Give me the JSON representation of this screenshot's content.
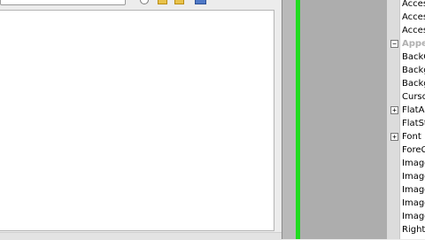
{
  "properties": {
    "rows": [
      {
        "label": "Acces",
        "toggle": ""
      },
      {
        "label": "Acces",
        "toggle": ""
      },
      {
        "label": "Acces",
        "toggle": ""
      },
      {
        "label": "Appe",
        "toggle": "−",
        "category": true
      },
      {
        "label": "BackC",
        "toggle": ""
      },
      {
        "label": "Backg",
        "toggle": ""
      },
      {
        "label": "Backg",
        "toggle": ""
      },
      {
        "label": "Curso",
        "toggle": ""
      },
      {
        "label": "FlatAp",
        "toggle": "+"
      },
      {
        "label": "FlatSt",
        "toggle": ""
      },
      {
        "label": "Font",
        "toggle": "+"
      },
      {
        "label": "ForeC",
        "toggle": ""
      },
      {
        "label": "Image",
        "toggle": ""
      },
      {
        "label": "Image",
        "toggle": ""
      },
      {
        "label": "Image",
        "toggle": ""
      },
      {
        "label": "Image",
        "toggle": ""
      },
      {
        "label": "Image",
        "toggle": ""
      },
      {
        "label": "Right",
        "toggle": ""
      }
    ]
  },
  "colors": {
    "selection_border": "#1fdc1f",
    "designer_background": "#adadad"
  }
}
